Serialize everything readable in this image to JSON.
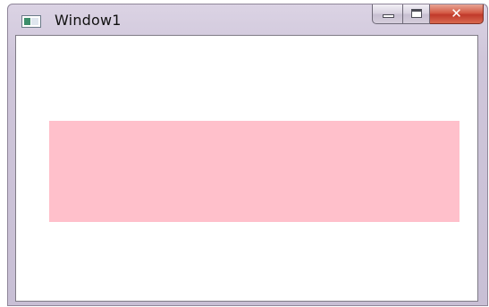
{
  "window": {
    "title": "Window1",
    "icon": "wpf-window-icon",
    "buttons": {
      "minimize": "minimize-icon",
      "maximize": "maximize-icon",
      "close": "close-icon"
    },
    "close_glyph": "✕"
  },
  "content": {
    "rectangle_fill": "#ffc0cb"
  }
}
